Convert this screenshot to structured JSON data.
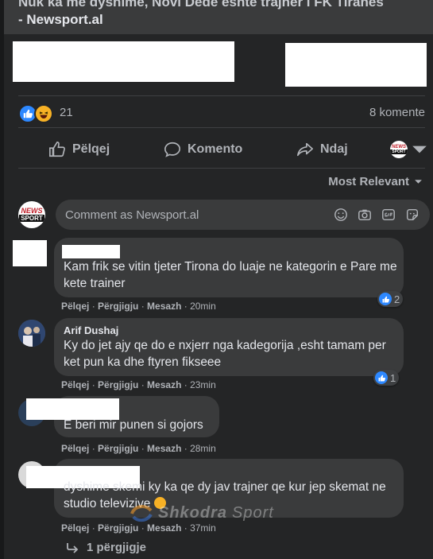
{
  "post": {
    "title_line1": "Nuk ka më dyshime, Novi Dede është trajner i FK Tiranës",
    "title_line2": "- Newsport.al"
  },
  "reactions": {
    "count": "21",
    "icons": [
      "like-icon",
      "haha-icon"
    ],
    "comments_label": "8 komente"
  },
  "actions": {
    "like": "Pëlqej",
    "comment": "Komento",
    "share": "Ndaj"
  },
  "sort": {
    "label": "Most Relevant"
  },
  "composer": {
    "placeholder": "Comment as Newsport.al",
    "avatar_text_top": "NEWS",
    "avatar_text_bottom": "SPORT",
    "icons": [
      "emoji-icon",
      "camera-icon",
      "gif-icon",
      "sticker-icon"
    ]
  },
  "comments": [
    {
      "author": "",
      "text": "Kam frik se vitin tjeter Tirona do luaje ne kategorin e Pare me kete trainer",
      "like": "Pëlqej",
      "reply": "Përgjigju",
      "message": "Mesazh",
      "time": "20min",
      "likes": "2"
    },
    {
      "author": "Arif Dushaj",
      "text": "Ky do jet ajy qe do e nxjerr nga kadegorija ,esht tamam per ket pun ka dhe ftyren fikseee",
      "like": "Pëlqej",
      "reply": "Përgjigju",
      "message": "Mesazh",
      "time": "23min",
      "likes": "1"
    },
    {
      "author": "",
      "text": "E beri mir punen si gojors",
      "like": "Pëlqej",
      "reply": "Përgjigju",
      "message": "Mesazh",
      "time": "28min"
    },
    {
      "author": "",
      "text": "dyshime skemi ky ka qe dy jav trajner qe kur jep skemat ne studio televizive",
      "like": "Pëlqej",
      "reply": "Përgjigju",
      "message": "Mesazh",
      "time": "37min",
      "replies": "1 përgjigje"
    }
  ],
  "watermark": {
    "brand": "Shkodra",
    "brand2": "Sport"
  },
  "colors": {
    "background": "#18191a",
    "card": "#242526",
    "bubble": "#3a3b3c",
    "text": "#e4e6eb",
    "muted": "#b0b3b8",
    "like_blue": "#2d88ff",
    "haha_yellow": "#f7b125"
  }
}
